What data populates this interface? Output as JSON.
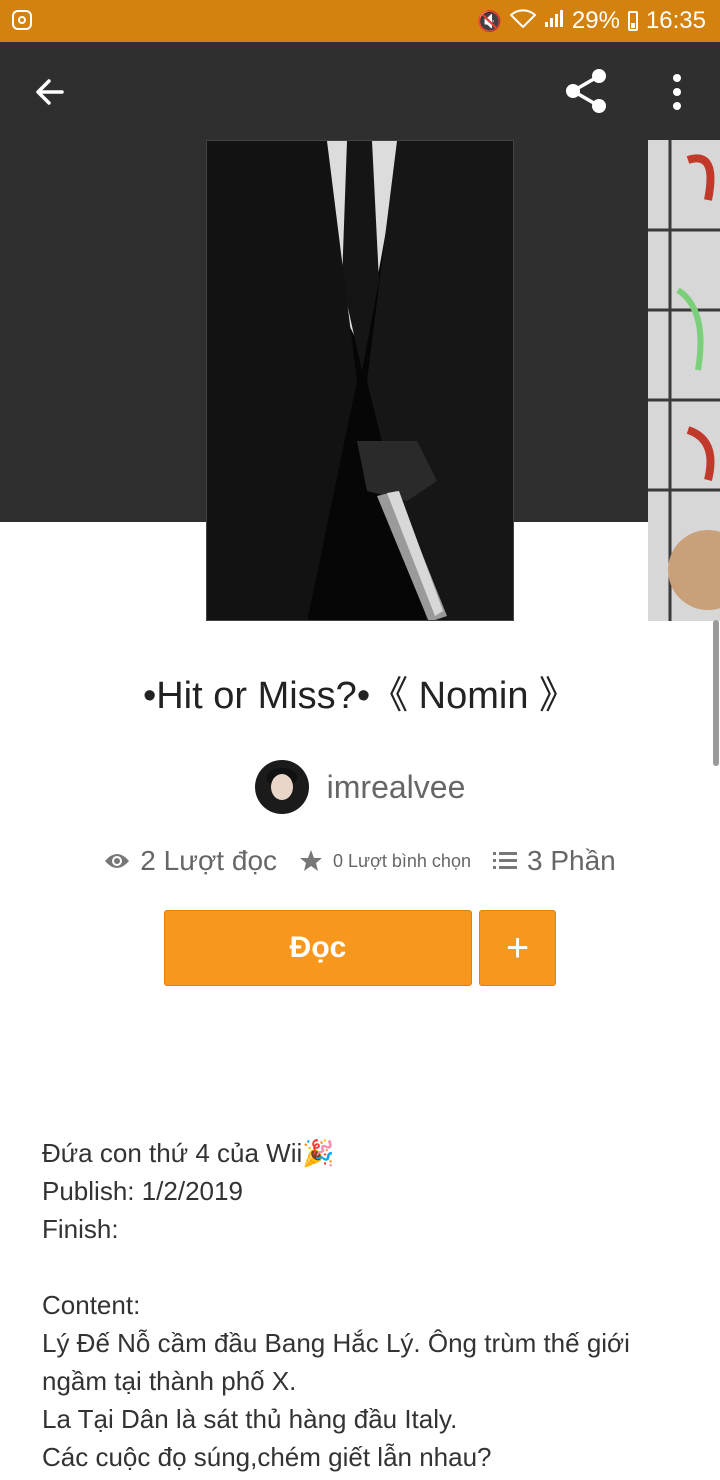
{
  "status_bar": {
    "battery": "29%",
    "time": "16:35"
  },
  "icons": {
    "back": "arrow-left-icon",
    "share": "share-icon",
    "more": "more-vert-icon",
    "views": "eye-icon",
    "votes": "star-icon",
    "parts": "list-icon",
    "add": "plus-icon"
  },
  "story": {
    "title": "•Hit or Miss?•《 Nomin 》",
    "author": "imrealvee",
    "views": "2 Lượt đọc",
    "votes": "0 Lượt bình chọn",
    "parts": "3 Phần"
  },
  "actions": {
    "read_label": "Đọc",
    "add_label": "+"
  },
  "description": {
    "lines": [
      "Đứa con thứ 4 của Wii🎉",
      "Publish: 1/2/2019",
      "Finish:",
      "",
      "Content:",
      "Lý Đế Nỗ cầm đầu Bang Hắc Lý. Ông trùm thế giới ngầm tại thành phố X.",
      "La Tại Dân là sát thủ hàng đầu Italy.",
      "Các cuộc đọ súng,chém giết lẫn nhau?"
    ]
  },
  "colors": {
    "accent": "#f7971d",
    "status_bar": "#d4820f",
    "header": "#2f2f2f"
  }
}
